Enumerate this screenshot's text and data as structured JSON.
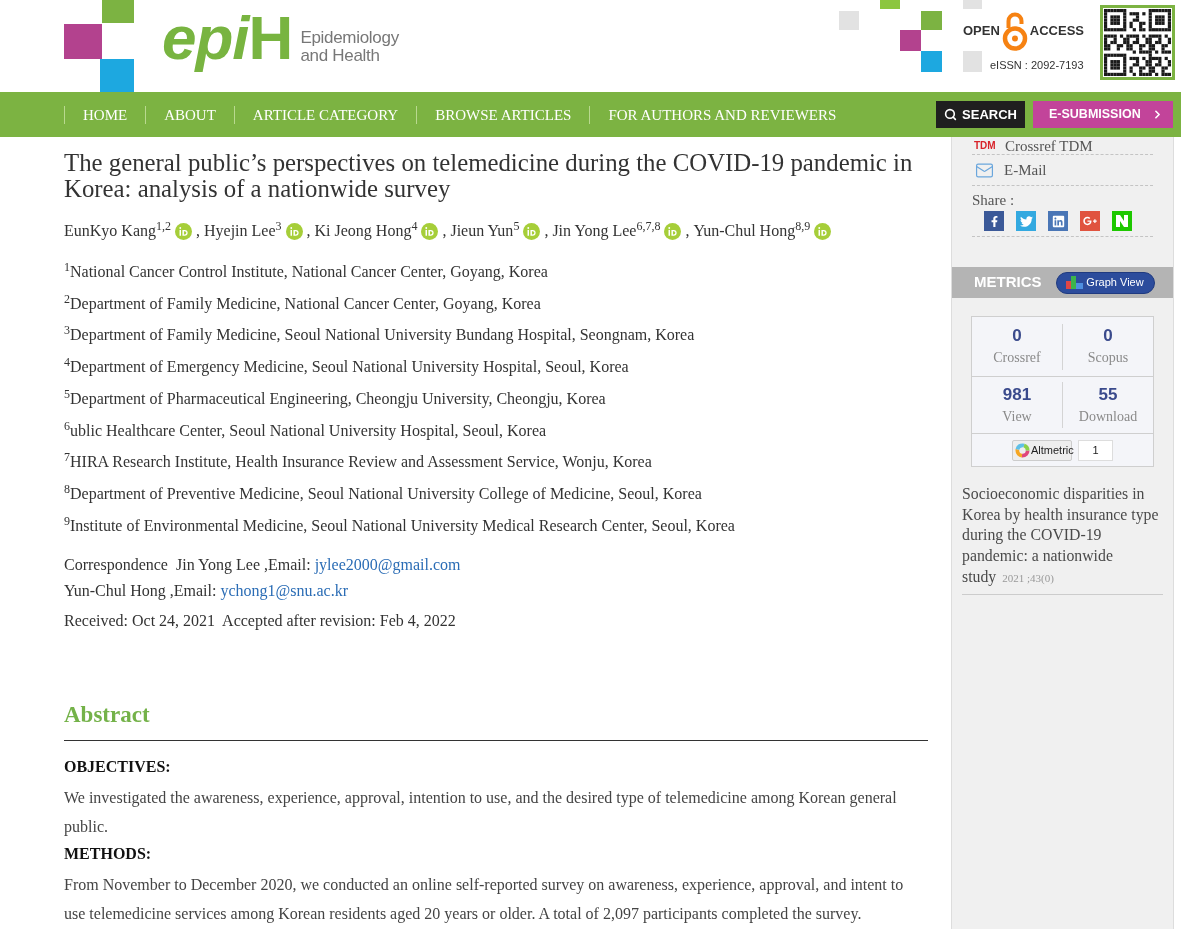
{
  "header": {
    "logo": {
      "mark": [
        "epi",
        "H"
      ],
      "subtitle": [
        "Epidemiology",
        "and Health"
      ]
    },
    "open_access": {
      "left": "OPEN",
      "right": "ACCESS"
    },
    "eissn": "eISSN : 2092-7193"
  },
  "nav": {
    "items": [
      {
        "label": "HOME"
      },
      {
        "label": "ABOUT"
      },
      {
        "label": "ARTICLE CATEGORY"
      },
      {
        "label": "BROWSE ARTICLES"
      },
      {
        "label": "FOR AUTHORS AND REVIEWERS"
      }
    ],
    "search": "SEARCH",
    "submission": "E-SUBMISSION"
  },
  "article": {
    "title": "The general public’s perspectives on telemedicine during the COVID-19 pandemic in Korea: analysis of a nationwide survey",
    "authors": [
      {
        "name": "EunKyo Kang$^{1,2}$"
      },
      {
        "separator": ",",
        "name": "Hyejin Lee$^{3}$"
      },
      {
        "separator": ",",
        "name": "Ki Jeong Hong$^{4}$"
      },
      {
        "separator": ",",
        "name": "Jieun Yun$^{5}$"
      },
      {
        "separator": ",",
        "name": "Jin Yong Lee$^{6,7,8}$"
      },
      {
        "separator": ",",
        "name": "Yun-Chul Hong$^{8,9}$"
      }
    ],
    "affiliations": [
      "$^{1}$National Cancer Control Institute, National Cancer Center, Goyang, Korea",
      "$^{2}$Department of Family Medicine, National Cancer Center, Goyang, Korea",
      "$^{3}$Department of Family Medicine, Seoul National University Bundang Hospital, Seongnam, Korea",
      "$^{4}$Department of Emergency Medicine, Seoul National University Hospital, Seoul, Korea",
      "$^{5}$Department of Pharmaceutical Engineering, Cheongju University, Cheongju, Korea",
      "$^{6}$ublic Healthcare Center, Seoul National University Hospital, Seoul, Korea",
      "$^{7}$HIRA Research Institute, Health Insurance Review and Assessment Service, Wonju, Korea",
      "$^{8}$Department of Preventive Medicine, Seoul National University College of Medicine, Seoul, Korea",
      "$^{9}$Institute of Environmental Medicine, Seoul National University Medical Research Center, Seoul, Korea"
    ],
    "correspondence": [
      {
        "label": "Correspondence",
        "text": "Jin Yong Lee ,Email:",
        "email": "jylee2000@gmail.com"
      },
      {
        "text": "Yun-Chul Hong ,Email:",
        "email": "ychong1@snu.ac.kr"
      }
    ],
    "dates": [
      "Received: Oct 24, 2021",
      "Accepted after revision: Feb 4, 2022"
    ],
    "abstract": {
      "heading": "Abstract",
      "sections": [
        {
          "heading": "OBJECTIVES:",
          "text": "We investigated the awareness, experience, approval, intention to use, and the desired type of telemedicine among Korean general public."
        },
        {
          "heading": "METHODS:",
          "text": "From November to December 2020, we conducted an online self-reported survey on awareness, experience, approval, and intent to use telemedicine services among Korean residents aged 20 years or older. A total of 2,097 participants completed the survey."
        }
      ]
    }
  },
  "sidebar": {
    "links": [
      {
        "kind": "tdm",
        "badge": "TDM",
        "label": "Crossref TDM"
      },
      {
        "kind": "email",
        "label": "E-Mail"
      }
    ],
    "share": {
      "label": "Share :",
      "buttons": [
        {
          "kind": "facebook"
        },
        {
          "kind": "twitter"
        },
        {
          "kind": "linkedin"
        },
        {
          "kind": "googleplus"
        },
        {
          "kind": "naver"
        }
      ]
    },
    "metrics": {
      "title": "METRICS",
      "graph_button": "Graph View",
      "rows": [
        [
          {
            "value": "0",
            "label": "Crossref"
          },
          {
            "value": "0",
            "label": "Scopus"
          }
        ],
        [
          {
            "value": "981",
            "label": "View"
          },
          {
            "value": "55",
            "label": "Download"
          }
        ]
      ],
      "altmetric": {
        "badge": "Altmetric",
        "count": "1"
      }
    },
    "related": [
      {
        "title": "Socioeconomic disparities in Korea by health insurance type during the COVID-19 pandemic: a nationwide study",
        "citation": "2021 ;43(0)"
      }
    ]
  }
}
